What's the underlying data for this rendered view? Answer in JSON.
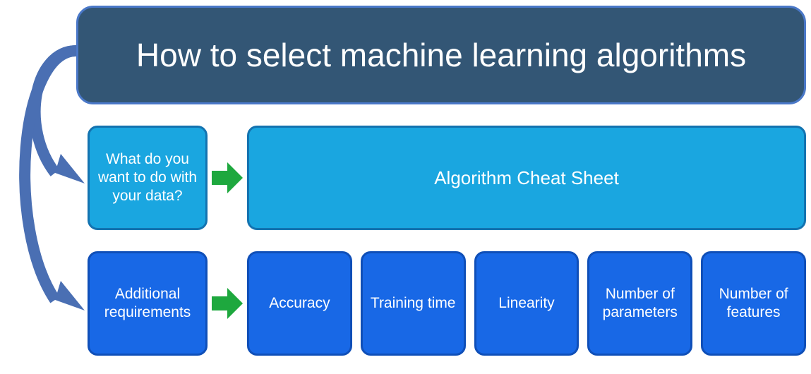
{
  "title": "How to select machine learning algorithms",
  "row2": {
    "question": "What do you want to do with your data?",
    "target": "Algorithm Cheat Sheet"
  },
  "row3": {
    "label": "Additional requirements",
    "items": [
      "Accuracy",
      "Training time",
      "Linearity",
      "Number of parameters",
      "Number of features"
    ]
  }
}
